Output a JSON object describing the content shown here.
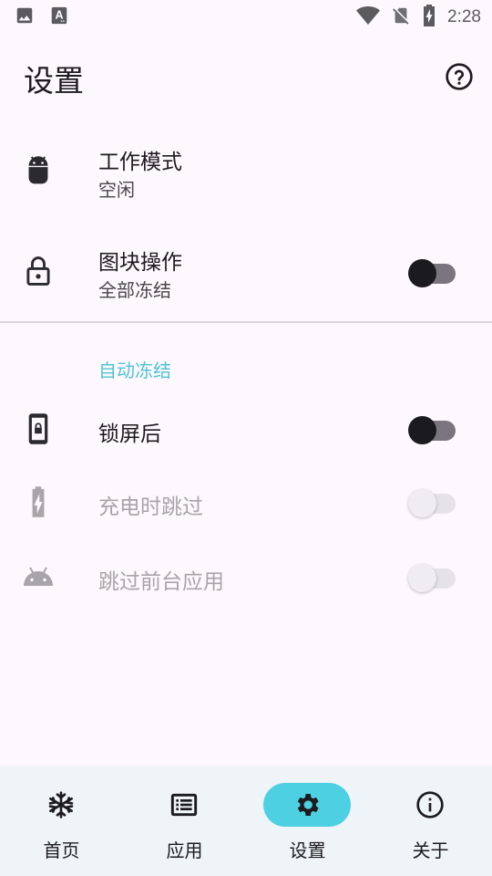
{
  "status_bar": {
    "time": "2:28",
    "left_icons": [
      "image-icon",
      "font-a-icon"
    ],
    "right_icons": [
      "wifi-icon",
      "no-sim-icon",
      "battery-charging-icon"
    ]
  },
  "header": {
    "title": "设置",
    "help_icon": "help-circle-icon"
  },
  "settings": {
    "work_mode": {
      "title": "工作模式",
      "subtitle": "空闲",
      "icon": "android-icon"
    },
    "tile_action": {
      "title": "图块操作",
      "subtitle": "全部冻结",
      "icon": "lock-icon",
      "switch_on": false
    }
  },
  "auto_freeze": {
    "header": "自动冻结",
    "header_color": "#4fc3d6",
    "items": [
      {
        "title": "锁屏后",
        "icon": "phone-lock-icon",
        "enabled": true,
        "switch_on": false
      },
      {
        "title": "充电时跳过",
        "icon": "battery-charging-icon",
        "enabled": false,
        "switch_on": false
      },
      {
        "title": "跳过前台应用",
        "icon": "android-head-icon",
        "enabled": false,
        "switch_on": false
      }
    ]
  },
  "bottom_nav": {
    "active_color": "#4dd0e1",
    "items": [
      {
        "label": "首页",
        "icon": "snowflake-icon",
        "active": false
      },
      {
        "label": "应用",
        "icon": "list-icon",
        "active": false
      },
      {
        "label": "设置",
        "icon": "gear-icon",
        "active": true
      },
      {
        "label": "关于",
        "icon": "info-icon",
        "active": false
      }
    ]
  }
}
